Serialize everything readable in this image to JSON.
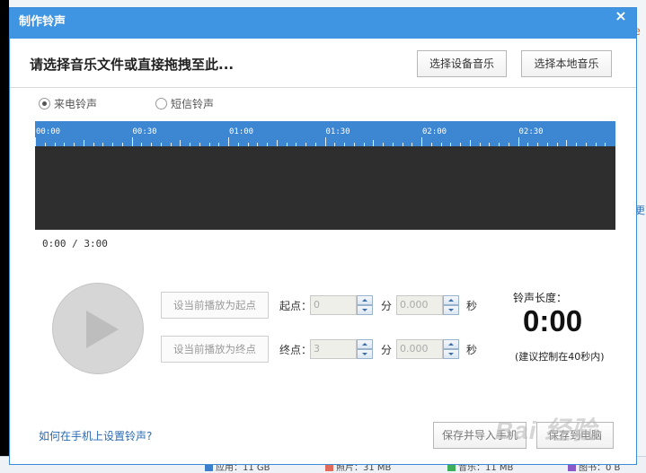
{
  "window": {
    "title": "制作铃声",
    "close_icon": "×"
  },
  "header": {
    "instruction": "请选择音乐文件或直接拖拽至此...",
    "select_device_music": "选择设备音乐",
    "select_local_music": "选择本地音乐"
  },
  "ringtone_type": {
    "options": [
      {
        "label": "来电铃声",
        "checked": true
      },
      {
        "label": "短信铃声",
        "checked": false
      }
    ]
  },
  "timeline": {
    "ticks": [
      "00:00",
      "00:30",
      "01:00",
      "01:30",
      "02:00",
      "02:30"
    ],
    "readout": "0:00 / 3:00"
  },
  "controls": {
    "set_start_button": "设当前播放为起点",
    "set_end_button": "设当前播放为终点",
    "start_label": "起点：",
    "end_label": "终点：",
    "minute_unit": "分",
    "second_unit": "秒",
    "start_minute": "0",
    "start_second": "0.000",
    "end_minute": "3",
    "end_second": "0.000"
  },
  "duration": {
    "label": "铃声长度：",
    "value": "0:00",
    "hint": "(建议控制在40秒内)"
  },
  "footer": {
    "help_link": "如何在手机上设置铃声?",
    "save_import_button": "保存并导入手机",
    "save_pc_button": "保存到电脑"
  },
  "background": {
    "right_text": "Ie",
    "right_link": "更",
    "bottom_items": [
      {
        "label": "应用：11 GB",
        "color": "#3c7ec9"
      },
      {
        "label": "照片：31 MB",
        "color": "#e26a5a"
      },
      {
        "label": "音乐：11 MB",
        "color": "#3fae5a"
      },
      {
        "label": "图书：0 B",
        "color": "#8a59c7"
      }
    ]
  },
  "watermark": "Bai 经验"
}
